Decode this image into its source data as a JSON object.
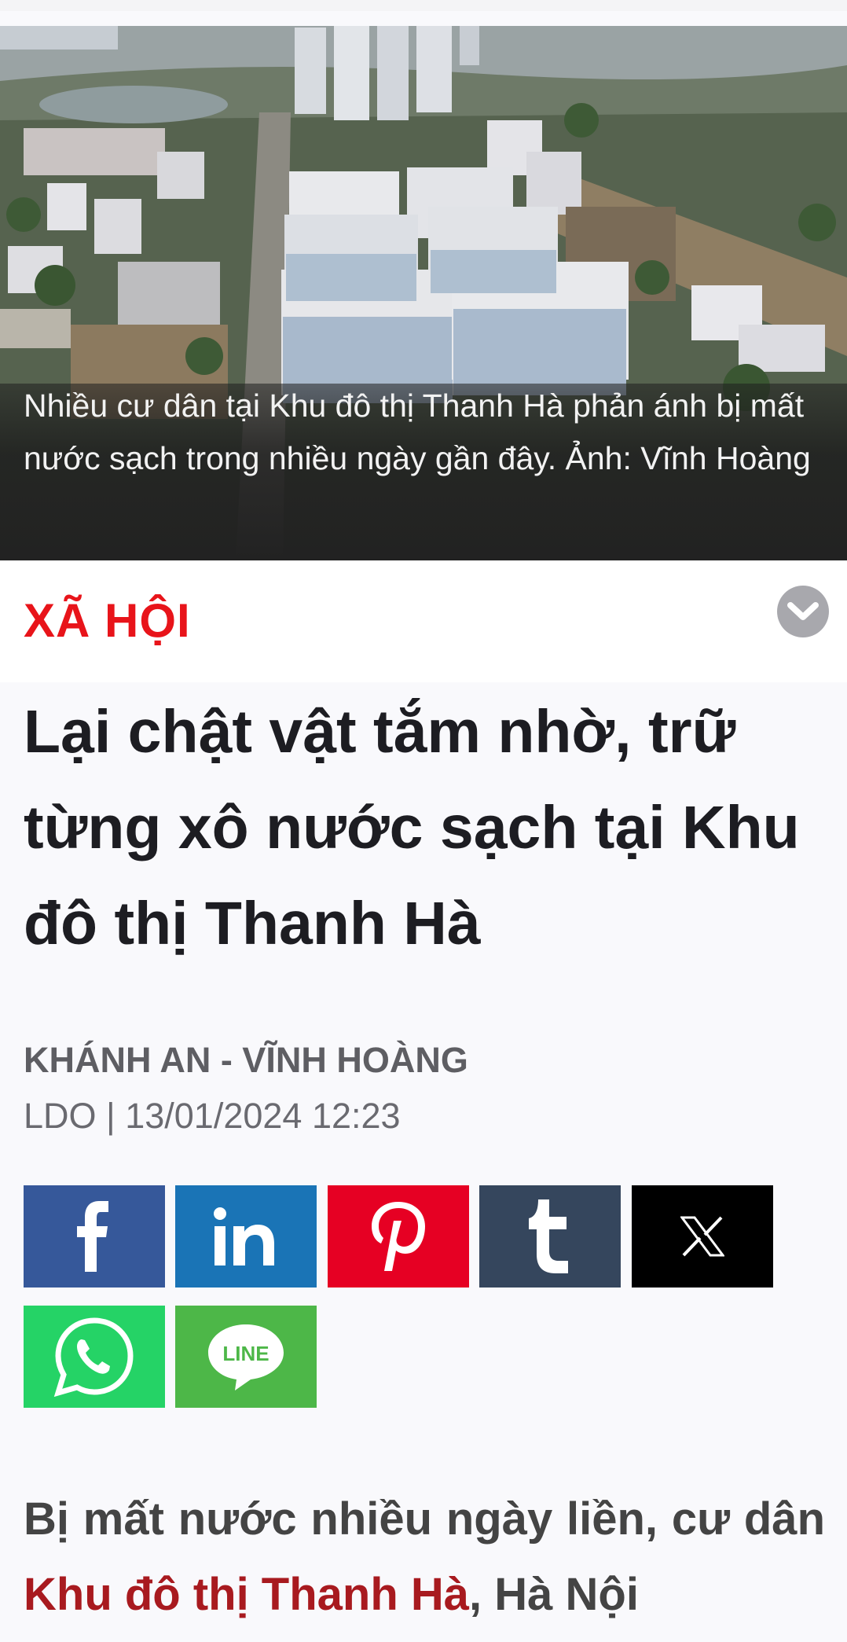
{
  "hero": {
    "caption": "Nhiều cư dân tại Khu đô thị Thanh Hà phản ánh bị mất nước sạch trong nhiều ngày gần đây. Ảnh: Vĩnh Hoàng"
  },
  "section": {
    "label": "XÃ HỘI"
  },
  "article": {
    "headline": "Lại chật vật tắm nhờ, trữ từng xô nước sạch tại Khu đô thị Thanh Hà",
    "author": "KHÁNH AN - VĨNH HOÀNG",
    "meta": "LDO | 13/01/2024 12:23",
    "lead_part1": "Bị mất nước nhiều ngày liền, cư dân ",
    "lead_link": "Khu đô thị Thanh Hà",
    "lead_part2": ", Hà Nội"
  },
  "share": {
    "facebook_color": "#36589a",
    "linkedin_color": "#1a74b6",
    "pinterest_color": "#e60023",
    "tumblr_color": "#35465d",
    "x_color": "#000000",
    "whatsapp_color": "#25d366",
    "line_label": "LINE",
    "line_color": "#4db748"
  },
  "colors": {
    "section_red": "#e8141a",
    "link_red": "#a81a1f"
  }
}
